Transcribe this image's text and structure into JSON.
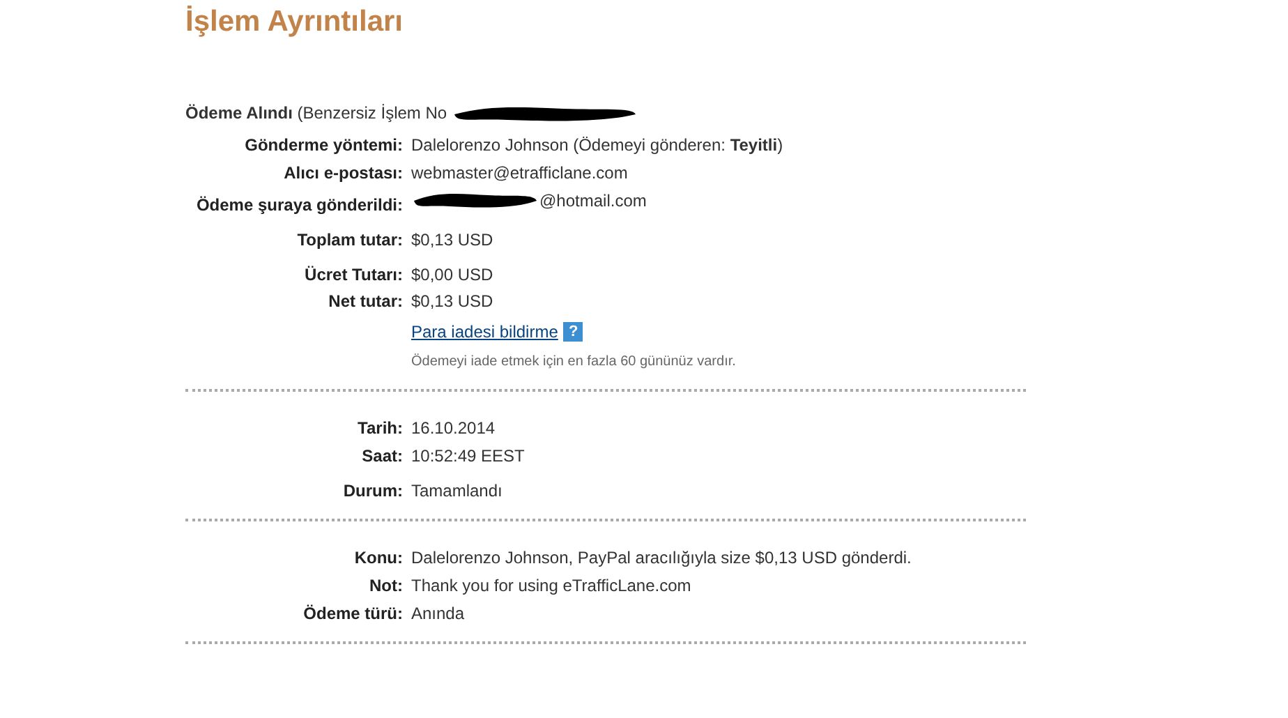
{
  "title": "İşlem Ayrıntıları",
  "receipt": {
    "text": "**Ödeme Alındı** (Benzersiz İşlem No",
    "redacted": true
  },
  "sections": [
    {
      "groups": [
        [
          {
            "label": "Gönderme yöntemi:",
            "value": "Dalelorenzo Johnson (Ödemeyi gönderen: **Teyitli**)"
          },
          {
            "label": "Alıcı e-postası:",
            "value": "webmaster@etrafficlane.com"
          },
          {
            "label": "Ödeme şuraya gönderildi:",
            "value": "@hotmail.com",
            "redacted": true
          }
        ],
        [
          {
            "label": "Toplam tutar:",
            "value": "$0,13 USD"
          }
        ],
        [
          {
            "label": "Ücret Tutarı:",
            "value": "$0,00 USD"
          },
          {
            "label": "Net tutar:",
            "value": "$0,13 USD"
          }
        ]
      ],
      "refund": {
        "link": "Para iadesi bildirme",
        "help": "?",
        "note": "Ödemeyi iade etmek için en fazla 60 gününüz vardır."
      }
    },
    {
      "groups": [
        [
          {
            "label": "Tarih:",
            "value": "16.10.2014"
          },
          {
            "label": "Saat:",
            "value": "10:52:49 EEST"
          }
        ],
        [
          {
            "label": "Durum:",
            "value": "Tamamlandı"
          }
        ]
      ]
    },
    {
      "groups": [
        [
          {
            "label": "Konu:",
            "value": "Dalelorenzo Johnson, PayPal aracılığıyla size $0,13 USD gönderdi."
          },
          {
            "label": "Not:",
            "value": "Thank you for using eTrafficLane.com"
          },
          {
            "label": "Ödeme türü:",
            "value": "Anında"
          }
        ]
      ]
    }
  ]
}
